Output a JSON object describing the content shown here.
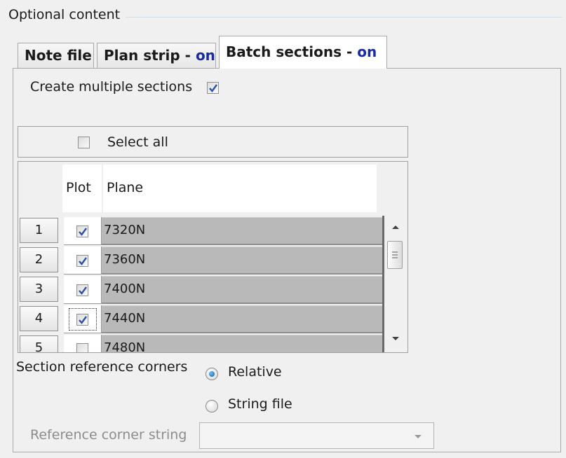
{
  "group_title": "Optional content",
  "tabs": [
    {
      "label": "Note file",
      "status": ""
    },
    {
      "label": "Plan strip - ",
      "status": "on"
    },
    {
      "label": "Batch sections - ",
      "status": "on"
    }
  ],
  "active_tab": "Batch sections",
  "create_multiple_sections": {
    "label": "Create multiple sections",
    "checked": true
  },
  "select_all": {
    "label": "Select all",
    "checked": false
  },
  "grid": {
    "columns": [
      "Plot",
      "Plane"
    ],
    "rows": [
      {
        "num": "1",
        "plot": true,
        "plane": "7320N"
      },
      {
        "num": "2",
        "plot": true,
        "plane": "7360N"
      },
      {
        "num": "3",
        "plot": true,
        "plane": "7400N"
      },
      {
        "num": "4",
        "plot": true,
        "plane": "7440N"
      },
      {
        "num": "5",
        "plot": false,
        "plane": "7480N"
      }
    ]
  },
  "section_reference_corners": {
    "label": "Section reference corners",
    "options": [
      "Relative",
      "String file"
    ],
    "selected": "Relative"
  },
  "reference_corner_string": {
    "label": "Reference corner string",
    "value": "",
    "enabled": false
  },
  "colors": {
    "on_status": "#1a2aa0",
    "radio_selected": "#0e5a9a"
  }
}
